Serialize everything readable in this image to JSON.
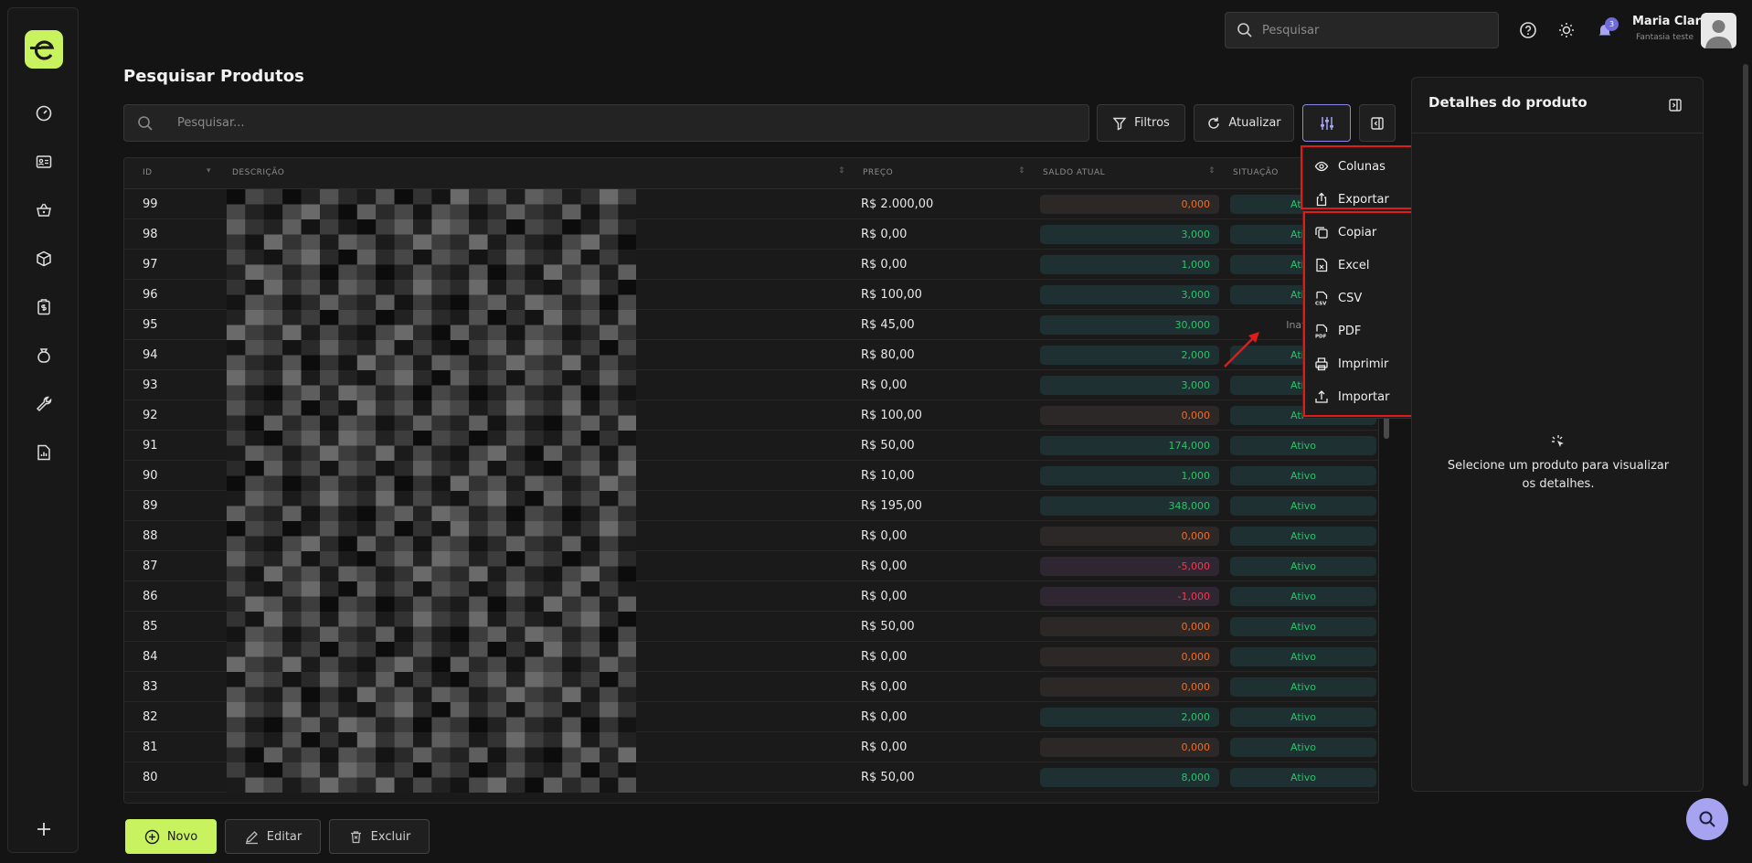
{
  "topbar": {
    "search_placeholder": "Pesquisar",
    "notification_count": "3",
    "user_name": "Maria Clara",
    "user_company": "Fantasia teste"
  },
  "sidebar": {
    "items": [
      {
        "icon": "dashboard-gauge-icon"
      },
      {
        "icon": "contacts-card-icon"
      },
      {
        "icon": "shopping-basket-icon"
      },
      {
        "icon": "package-box-icon"
      },
      {
        "icon": "finance-clipboard-icon"
      },
      {
        "icon": "money-bag-icon"
      },
      {
        "icon": "wrench-tools-icon"
      },
      {
        "icon": "reports-chart-icon"
      }
    ],
    "add_icon": "plus-icon"
  },
  "page": {
    "title": "Pesquisar Produtos",
    "search_placeholder": "Pesquisar...",
    "filters_label": "Filtros",
    "refresh_label": "Atualizar"
  },
  "table": {
    "columns": [
      "ID",
      "DESCRIÇÃO",
      "PREÇO",
      "SALDO ATUAL",
      "SITUAÇÃO"
    ],
    "rows": [
      {
        "id": "99",
        "preco": "R$ 2.000,00",
        "saldo": "0,000",
        "saldo_kind": "zero",
        "situacao": "Ativo"
      },
      {
        "id": "98",
        "preco": "R$ 0,00",
        "saldo": "3,000",
        "saldo_kind": "pos",
        "situacao": "Ativo"
      },
      {
        "id": "97",
        "preco": "R$ 0,00",
        "saldo": "1,000",
        "saldo_kind": "pos",
        "situacao": "Ativo"
      },
      {
        "id": "96",
        "preco": "R$ 100,00",
        "saldo": "3,000",
        "saldo_kind": "pos",
        "situacao": "Ativo"
      },
      {
        "id": "95",
        "preco": "R$ 45,00",
        "saldo": "30,000",
        "saldo_kind": "pos",
        "situacao": "Inativo"
      },
      {
        "id": "94",
        "preco": "R$ 80,00",
        "saldo": "2,000",
        "saldo_kind": "pos",
        "situacao": "Ativo"
      },
      {
        "id": "93",
        "preco": "R$ 0,00",
        "saldo": "3,000",
        "saldo_kind": "pos",
        "situacao": "Ativo"
      },
      {
        "id": "92",
        "preco": "R$ 100,00",
        "saldo": "0,000",
        "saldo_kind": "zero",
        "situacao": "Ativo"
      },
      {
        "id": "91",
        "preco": "R$ 50,00",
        "saldo": "174,000",
        "saldo_kind": "pos",
        "situacao": "Ativo"
      },
      {
        "id": "90",
        "preco": "R$ 10,00",
        "saldo": "1,000",
        "saldo_kind": "pos",
        "situacao": "Ativo"
      },
      {
        "id": "89",
        "preco": "R$ 195,00",
        "saldo": "348,000",
        "saldo_kind": "pos",
        "situacao": "Ativo"
      },
      {
        "id": "88",
        "preco": "R$ 0,00",
        "saldo": "0,000",
        "saldo_kind": "zero",
        "situacao": "Ativo"
      },
      {
        "id": "87",
        "preco": "R$ 0,00",
        "saldo": "-5,000",
        "saldo_kind": "neg",
        "situacao": "Ativo"
      },
      {
        "id": "86",
        "preco": "R$ 0,00",
        "saldo": "-1,000",
        "saldo_kind": "neg",
        "situacao": "Ativo"
      },
      {
        "id": "85",
        "preco": "R$ 50,00",
        "saldo": "0,000",
        "saldo_kind": "zero",
        "situacao": "Ativo"
      },
      {
        "id": "84",
        "preco": "R$ 0,00",
        "saldo": "0,000",
        "saldo_kind": "zero",
        "situacao": "Ativo"
      },
      {
        "id": "83",
        "preco": "R$ 0,00",
        "saldo": "0,000",
        "saldo_kind": "zero",
        "situacao": "Ativo"
      },
      {
        "id": "82",
        "preco": "R$ 0,00",
        "saldo": "2,000",
        "saldo_kind": "pos",
        "situacao": "Ativo"
      },
      {
        "id": "81",
        "preco": "R$ 0,00",
        "saldo": "0,000",
        "saldo_kind": "zero",
        "situacao": "Ativo"
      },
      {
        "id": "80",
        "preco": "R$ 50,00",
        "saldo": "8,000",
        "saldo_kind": "pos",
        "situacao": "Ativo"
      }
    ]
  },
  "dropdown": {
    "items": [
      {
        "label": "Colunas",
        "icon": "eye-icon",
        "chevron": ""
      },
      {
        "label": "Exportar",
        "icon": "share-upload-icon",
        "chevron": "up"
      },
      {
        "label": "Copiar",
        "icon": "copy-icon",
        "chevron": ""
      },
      {
        "label": "Excel",
        "icon": "excel-file-icon",
        "chevron": "down"
      },
      {
        "label": "CSV",
        "icon": "csv-file-icon",
        "chevron": "down"
      },
      {
        "label": "PDF",
        "icon": "pdf-file-icon",
        "chevron": "down"
      },
      {
        "label": "Imprimir",
        "icon": "printer-icon",
        "chevron": "down"
      },
      {
        "label": "Importar",
        "icon": "upload-icon",
        "chevron": ""
      }
    ]
  },
  "details": {
    "title": "Detalhes do produto",
    "empty_message": "Selecione um produto para visualizar os detalhes."
  },
  "actions": {
    "new_label": "Novo",
    "edit_label": "Editar",
    "delete_label": "Excluir"
  },
  "colors": {
    "accent_green": "#c9f25f",
    "accent_purple": "#a6a3f0",
    "positive": "#2cc26a",
    "zero": "#f06d26",
    "negative": "#f03c55",
    "highlight": "#e11a1a"
  }
}
